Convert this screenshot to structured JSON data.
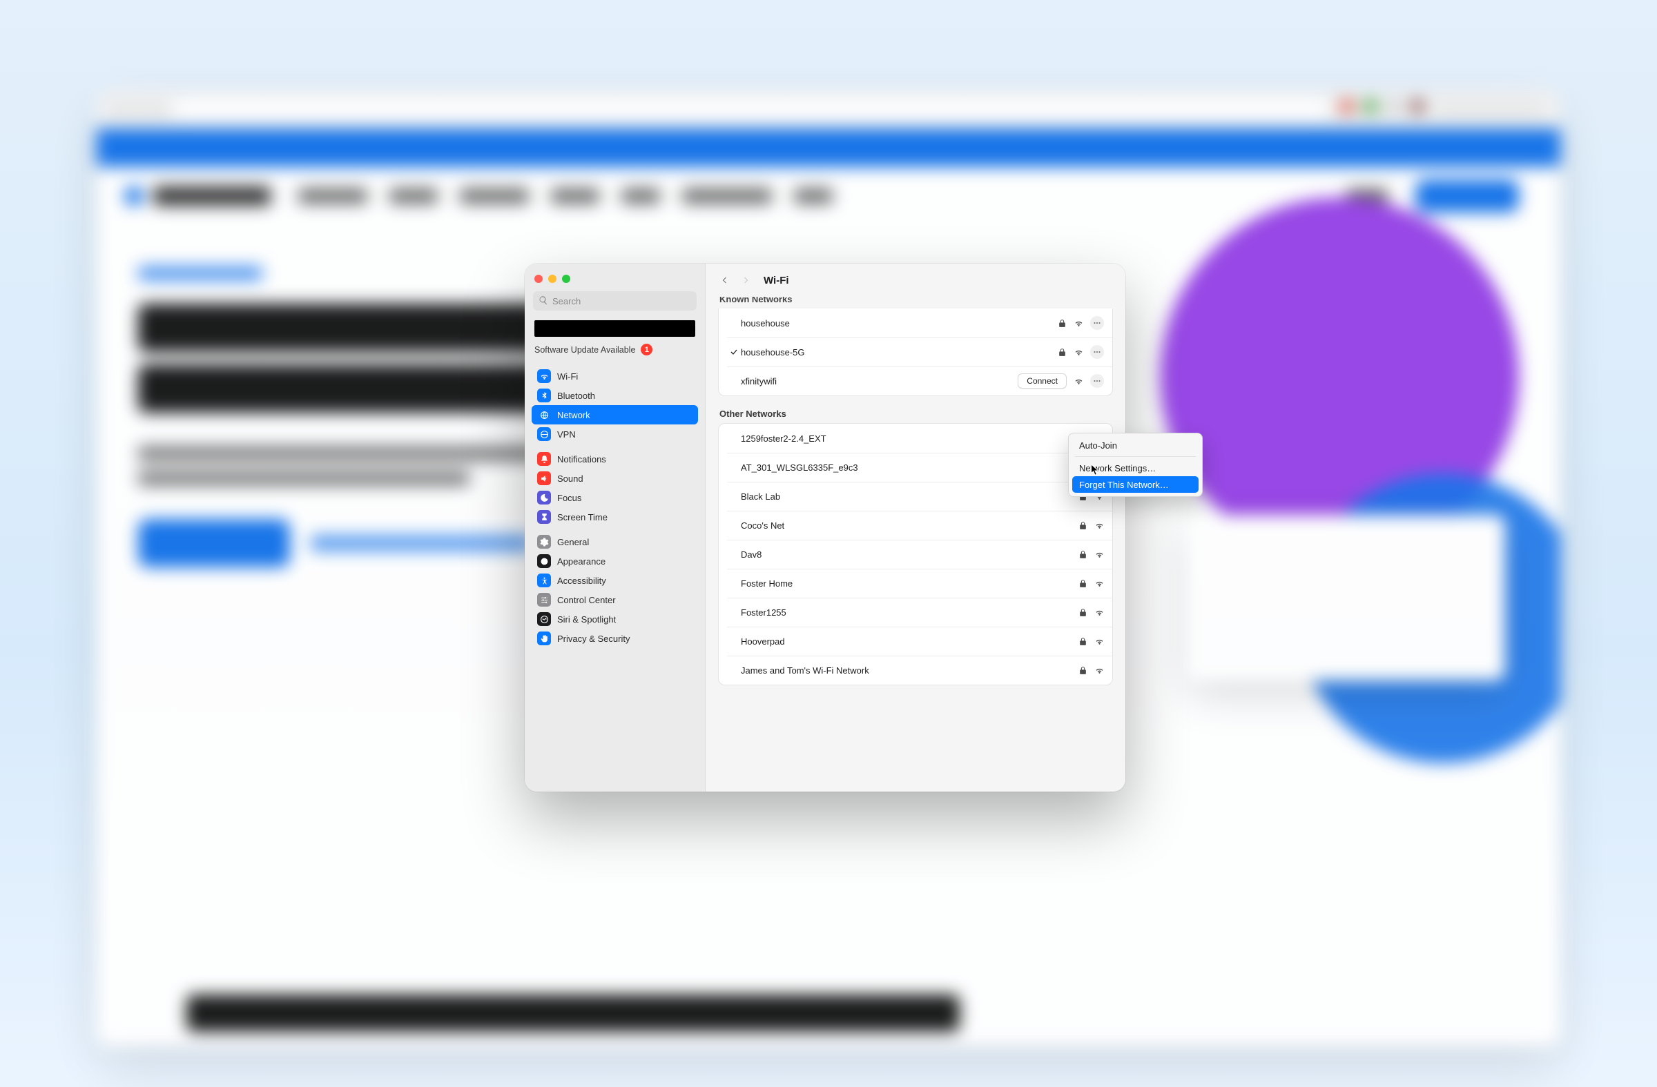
{
  "sidebar": {
    "search_placeholder": "Search",
    "update_label": "Software Update Available",
    "update_badge": "1",
    "items": [
      {
        "label": "Wi-Fi",
        "icon": "wifi",
        "color": "ic-blue"
      },
      {
        "label": "Bluetooth",
        "icon": "bluetooth",
        "color": "ic-blue"
      },
      {
        "label": "Network",
        "icon": "network",
        "color": "ic-blue",
        "selected": true
      },
      {
        "label": "VPN",
        "icon": "vpn",
        "color": "ic-blue"
      },
      {
        "label": "Notifications",
        "icon": "bell",
        "color": "ic-red"
      },
      {
        "label": "Sound",
        "icon": "sound",
        "color": "ic-red"
      },
      {
        "label": "Focus",
        "icon": "focus",
        "color": "ic-purple"
      },
      {
        "label": "Screen Time",
        "icon": "hourglass",
        "color": "ic-purple"
      },
      {
        "label": "General",
        "icon": "gear",
        "color": "ic-grey"
      },
      {
        "label": "Appearance",
        "icon": "appearance",
        "color": "ic-dark"
      },
      {
        "label": "Accessibility",
        "icon": "accessibility",
        "color": "ic-blue"
      },
      {
        "label": "Control Center",
        "icon": "controls",
        "color": "ic-grey"
      },
      {
        "label": "Siri & Spotlight",
        "icon": "siri",
        "color": "ic-dark"
      },
      {
        "label": "Privacy & Security",
        "icon": "hand",
        "color": "ic-blue"
      }
    ]
  },
  "content": {
    "title": "Wi-Fi",
    "known_title": "Known Networks",
    "other_title": "Other Networks",
    "connect_label": "Connect",
    "known": [
      {
        "name": "househouse",
        "locked": true,
        "connected": false,
        "more": true
      },
      {
        "name": "househouse-5G",
        "locked": true,
        "connected": true,
        "more": true
      },
      {
        "name": "xfinitywifi",
        "locked": false,
        "connected": false,
        "connect": true,
        "more": true
      }
    ],
    "other": [
      {
        "name": "1259foster2-2.4_EXT",
        "locked": true
      },
      {
        "name": "AT_301_WLSGL6335F_e9c3",
        "locked": true
      },
      {
        "name": "Black Lab",
        "locked": true
      },
      {
        "name": "Coco's Net",
        "locked": true
      },
      {
        "name": "Dav8",
        "locked": true
      },
      {
        "name": "Foster Home",
        "locked": true
      },
      {
        "name": "Foster1255",
        "locked": true
      },
      {
        "name": "Hooverpad",
        "locked": true
      },
      {
        "name": "James and Tom's Wi-Fi Network",
        "locked": true
      }
    ]
  },
  "context_menu": {
    "items": [
      {
        "label": "Auto-Join"
      },
      {
        "label": "Network Settings…"
      },
      {
        "label": "Forget This Network…",
        "selected": true
      }
    ]
  }
}
